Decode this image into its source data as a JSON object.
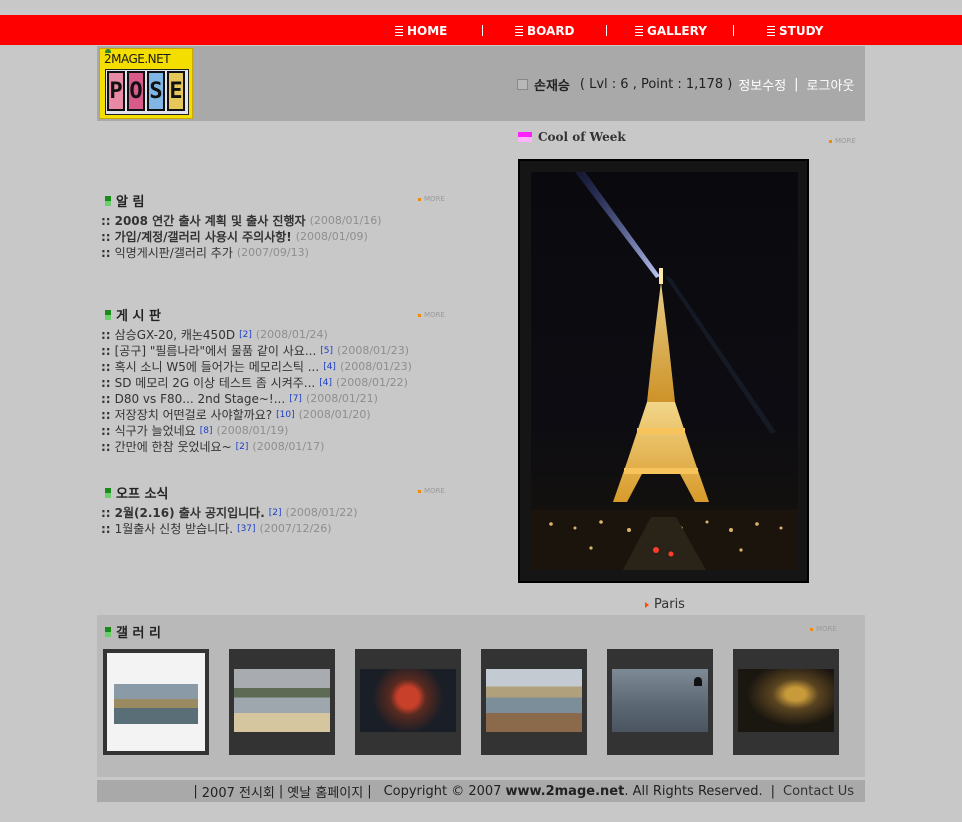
{
  "nav": {
    "items": [
      {
        "label": "HOME"
      },
      {
        "label": "BOARD"
      },
      {
        "label": "GALLERY"
      },
      {
        "label": "STUDY"
      }
    ]
  },
  "logo": {
    "site_name": "2MAGE.NET",
    "letters": [
      "P",
      "O",
      "S",
      "E"
    ]
  },
  "user": {
    "name": "손재승",
    "stats": "( Lvl : 6 , Point : 1,178 )",
    "edit_label": "정보수정",
    "separator": "|",
    "logout_label": "로그아웃"
  },
  "more_label": "MORE",
  "cool_of_week": {
    "title": "Cool of Week",
    "caption": "Paris"
  },
  "notice": {
    "title": "알 림",
    "items": [
      {
        "title": "2008 연간 출사 계획 및 출사 진행자",
        "date": "(2008/01/16)",
        "bold": true
      },
      {
        "title": "가입/계정/갤러리 사용시 주의사항!",
        "date": "(2008/01/09)",
        "bold": true
      },
      {
        "title": "익명게시판/갤러리 추가",
        "date": "(2007/09/13)",
        "bold": false
      }
    ]
  },
  "board": {
    "title": "게 시 판",
    "items": [
      {
        "title": "삼승GX-20, 캐논450D",
        "count": "[2]",
        "date": "(2008/01/24)"
      },
      {
        "title": "[공구] \"필름나라\"에서 물품 같이 사요...",
        "count": "[5]",
        "date": "(2008/01/23)"
      },
      {
        "title": "혹시 소니 W5에 들어가는 메모리스틱 ...",
        "count": "[4]",
        "date": "(2008/01/23)"
      },
      {
        "title": "SD 메모리 2G 이상 테스트 좀 시켜주...",
        "count": "[4]",
        "date": "(2008/01/22)"
      },
      {
        "title": "D80 vs F80... 2nd Stage~!...",
        "count": "[7]",
        "date": "(2008/01/21)"
      },
      {
        "title": "저장장치 어떤걸로 사야할까요?",
        "count": "[10]",
        "date": "(2008/01/20)"
      },
      {
        "title": "식구가 늘었네요",
        "count": "[8]",
        "date": "(2008/01/19)"
      },
      {
        "title": "간만에 한참 웃었네요~",
        "count": "[2]",
        "date": "(2008/01/17)"
      }
    ]
  },
  "off_news": {
    "title": "오프 소식",
    "items": [
      {
        "title": "2월(2.16) 출사 공지입니다.",
        "count": "[2]",
        "date": "(2008/01/22)",
        "bold": true
      },
      {
        "title": "1월출사 신청 받습니다.",
        "count": "[37]",
        "date": "(2007/12/26)",
        "bold": false
      }
    ]
  },
  "gallery": {
    "title": "갤 러 리"
  },
  "footer": {
    "pre_sep": "|",
    "exhibition": "2007 전시회",
    "sep": "|",
    "old_homepage": "옛날 홈페이지",
    "copyright_prefix": "Copyright © 2007",
    "site": "www.2mage.net",
    "copyright_suffix": ". All Rights Reserved.",
    "contact": "Contact Us"
  },
  "colors": {
    "topbar": "#ff0000",
    "page_bg": "#c8c8c8",
    "header_bg": "#a9a9a9",
    "logo_bg": "#f4de00"
  }
}
